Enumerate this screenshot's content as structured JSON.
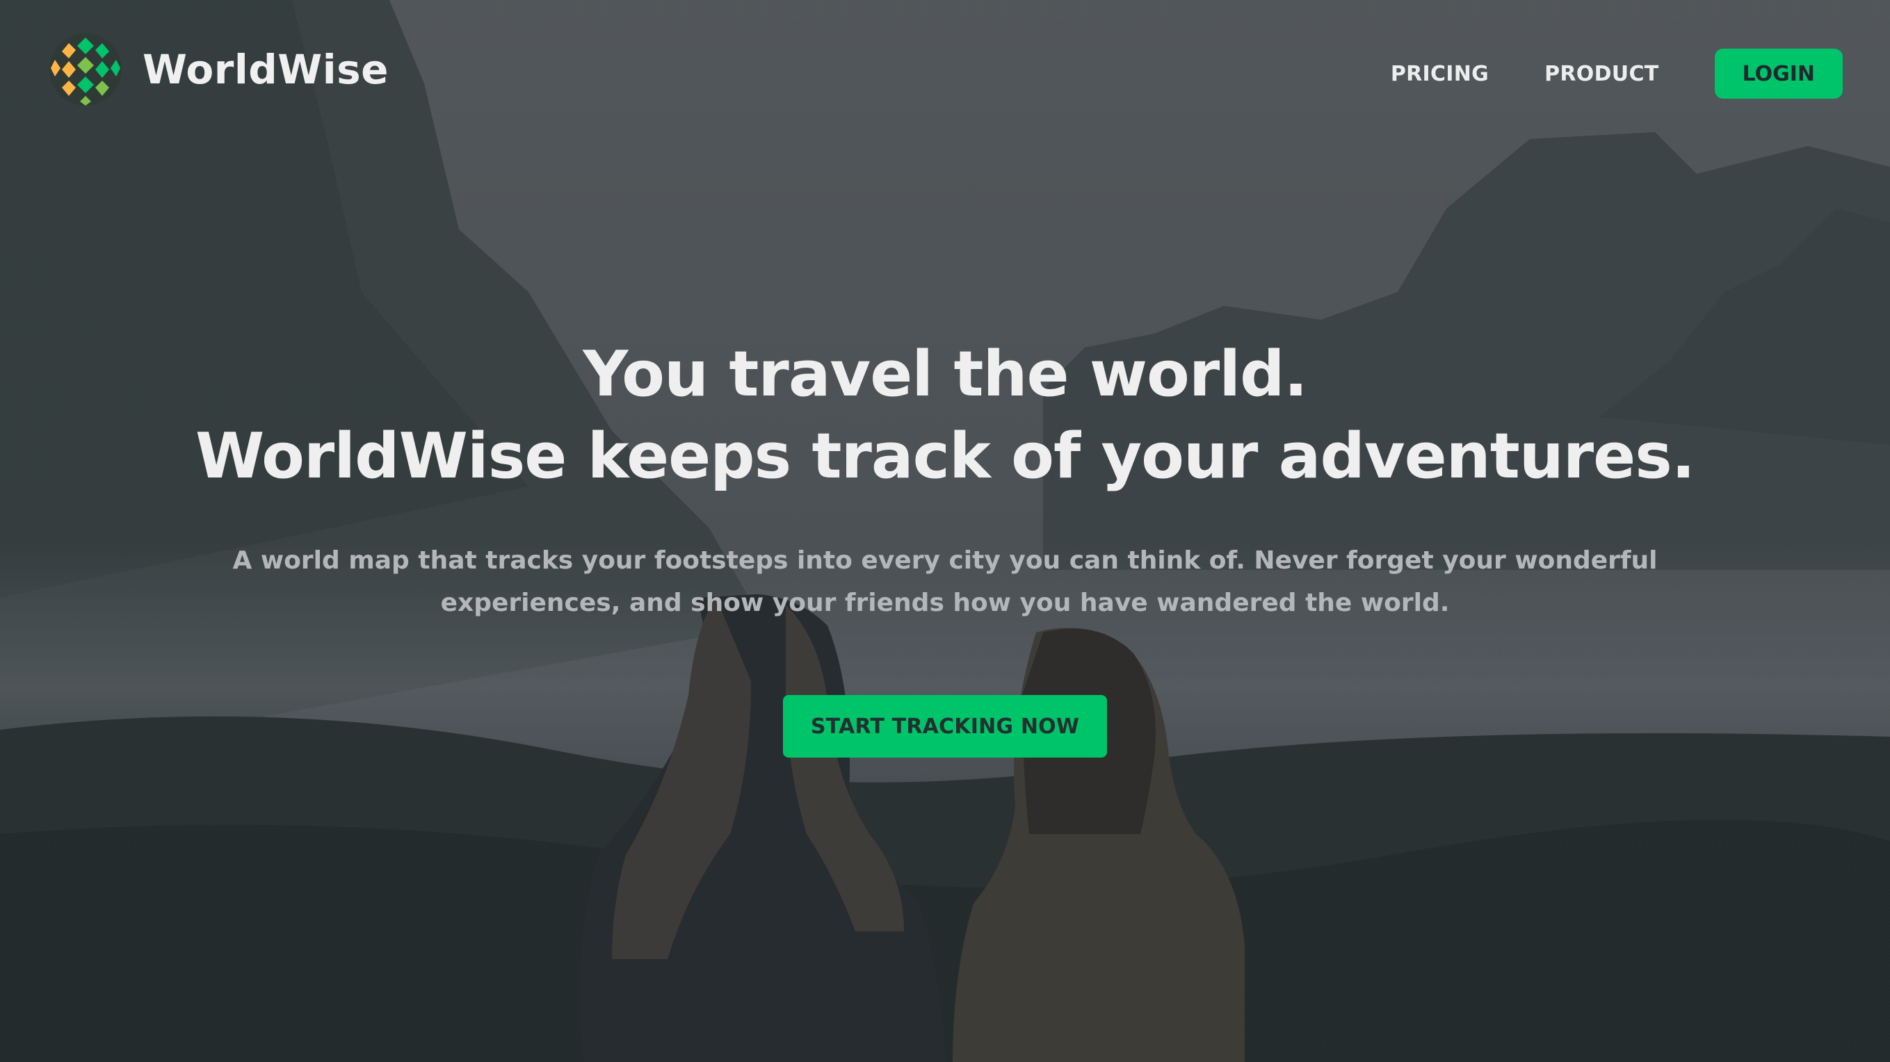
{
  "brand": {
    "name": "WorldWise",
    "logo_icon": "globe-logo-icon",
    "logo_colors": [
      "#ffb545",
      "#00c46a"
    ]
  },
  "nav": {
    "items": [
      {
        "label": "PRICING"
      },
      {
        "label": "PRODUCT"
      }
    ],
    "login_label": "LOGIN"
  },
  "hero": {
    "headline_line1": "You travel the world.",
    "headline_line2": "WorldWise keeps track of your adventures.",
    "description": "A world map that tracks your footsteps into every city you can think of. Never forget your wonderful experiences, and show your friends how you have wandered the world.",
    "cta_label": "START TRACKING NOW"
  },
  "colors": {
    "accent": "#00c46a",
    "accent_alt": "#ffb545",
    "text_light": "#efefef",
    "text_muted": "#b4b7b9"
  }
}
